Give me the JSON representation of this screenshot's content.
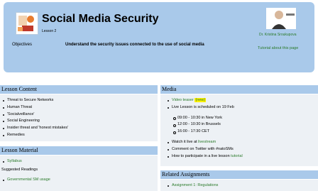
{
  "header": {
    "title": "Social Media Security",
    "lesson_number": "Lesson 2",
    "objectives_label": "Objectives",
    "objectives_text": "Understand the security issues connected to the use of social media",
    "author": "Dr. Kristina Sroukupova",
    "tutorial_link": "Tutorial about this page"
  },
  "lesson_content": {
    "title": "Lesson Content",
    "items": [
      "Threat to Secure Networks",
      "Human Threat",
      "'Socialveillance'",
      "Social Engineering",
      "Insider threat and 'honest mistakes'",
      "Remedies"
    ]
  },
  "lesson_material": {
    "title": "Lesson Material",
    "syllabus": "Syllabus",
    "suggested_label": "Suggested Readings",
    "reading_1": "Governmental SM usage"
  },
  "media": {
    "title": "Media",
    "video_teaser": "Video teaser",
    "new_badge": "(new)",
    "live_lesson": "Live Lesson is scheduled on 19 Feb",
    "times": [
      "09:00 - 10:30 in New York",
      "12:00 - 10:30 in Brussels",
      "16:00 - 17:30 CET"
    ],
    "watch_prefix": "Watch it live at",
    "watch_link": "livestream",
    "comment_prefix": "Comment on Twitter with",
    "hashtag": "#natoSMs",
    "participate_prefix": "How to participate in a live lesson",
    "participate_link": "tutorial"
  },
  "related": {
    "title": "Related Assignments",
    "assignment_1": "Assignment 1: Regulations"
  }
}
